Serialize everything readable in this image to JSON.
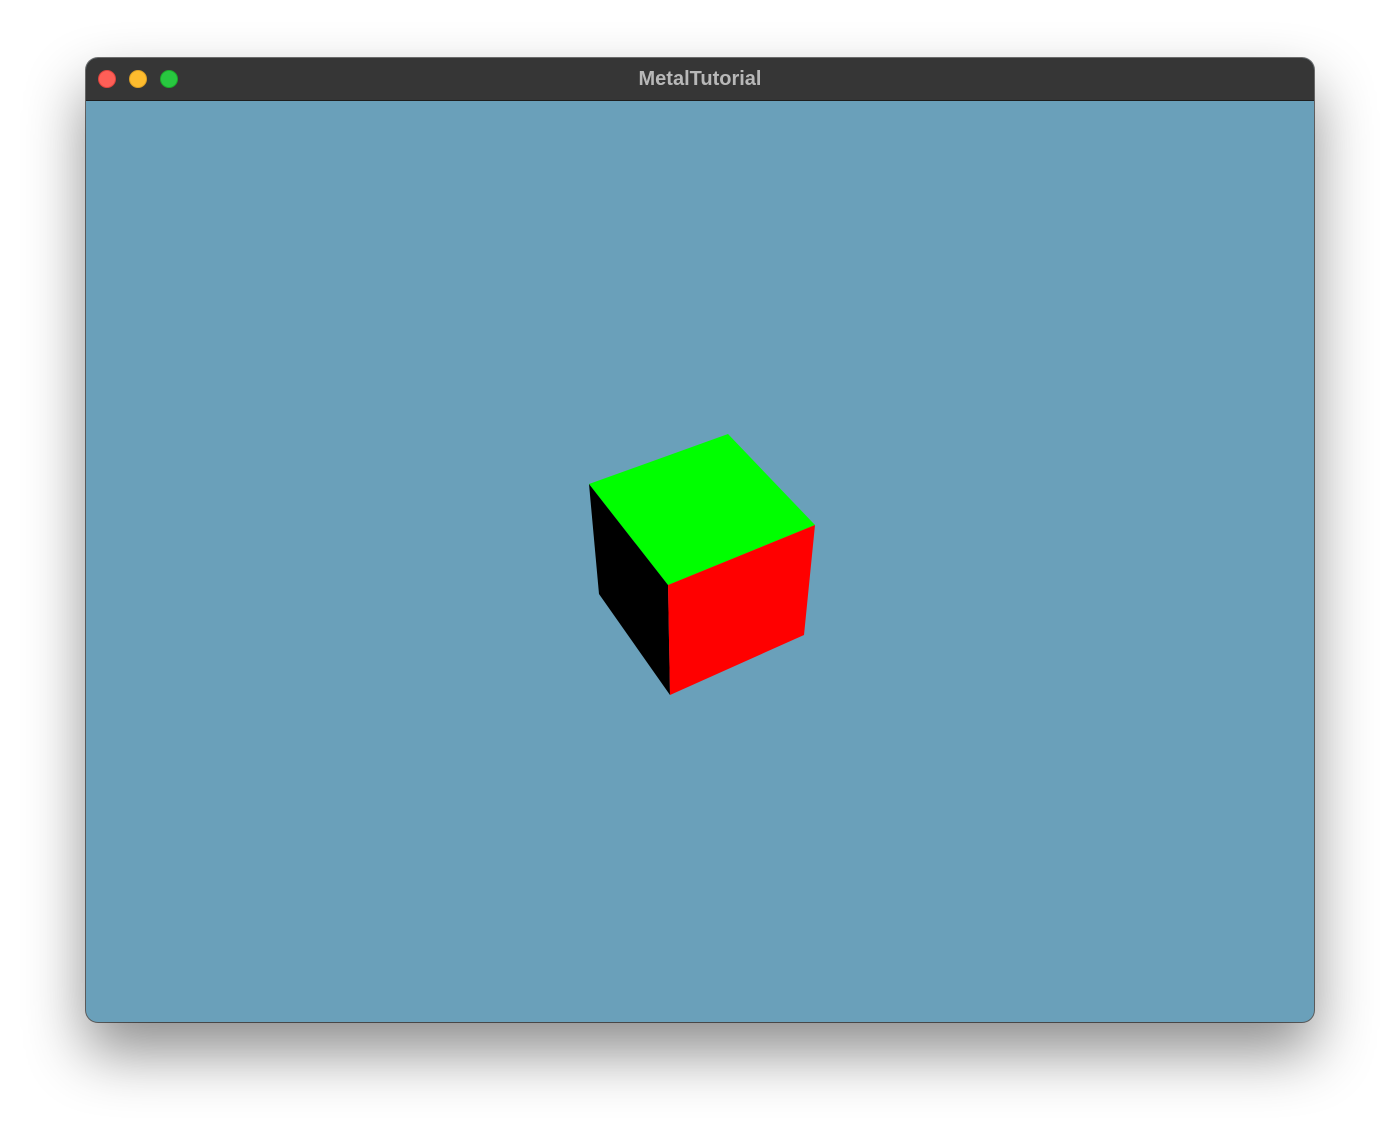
{
  "window": {
    "title": "MetalTutorial"
  },
  "colors": {
    "clear_color": "#6aa0ba",
    "titlebar": "#363636",
    "title_text": "#b8b8b8",
    "close_button": "#fe5f57",
    "minimize_button": "#febc2e",
    "zoom_button": "#28c840",
    "cube_top_face": "#00ff00",
    "cube_front_face": "#ff0000",
    "cube_left_face": "#000000"
  },
  "scene": {
    "object": "cube"
  }
}
